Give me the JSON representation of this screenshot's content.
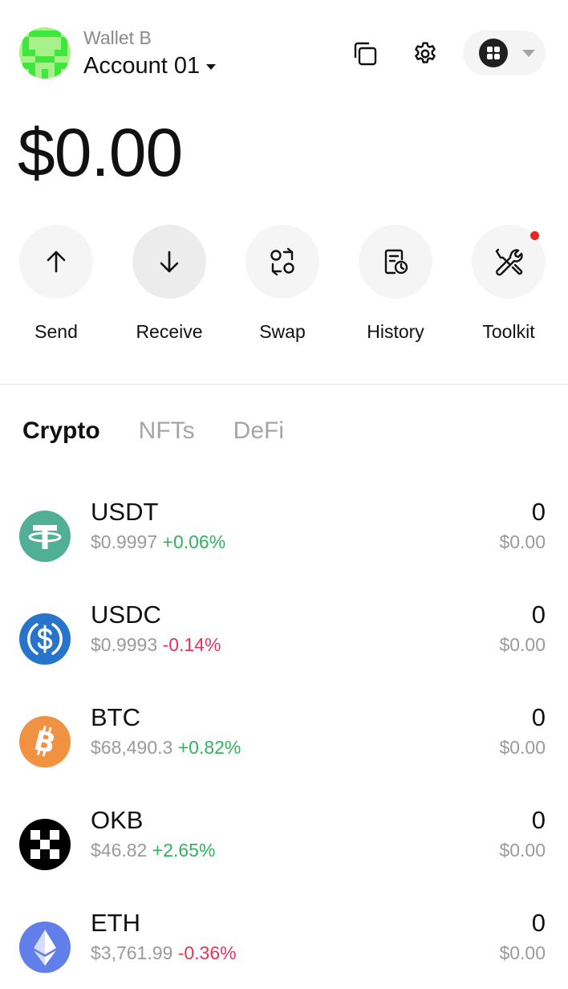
{
  "header": {
    "wallet_name": "Wallet B",
    "account_name": "Account 01"
  },
  "balance": "$0.00",
  "actions": [
    {
      "label": "Send",
      "icon": "arrow-up-icon"
    },
    {
      "label": "Receive",
      "icon": "arrow-down-icon"
    },
    {
      "label": "Swap",
      "icon": "swap-icon"
    },
    {
      "label": "History",
      "icon": "history-icon"
    },
    {
      "label": "Toolkit",
      "icon": "toolkit-icon"
    }
  ],
  "tabs": [
    {
      "label": "Crypto",
      "active": true
    },
    {
      "label": "NFTs",
      "active": false
    },
    {
      "label": "DeFi",
      "active": false
    }
  ],
  "tokens": [
    {
      "symbol": "USDT",
      "price": "$0.9997",
      "change": "+0.06%",
      "amount": "0",
      "value": "$0.00",
      "icon": "tether-icon",
      "color": "#50af95"
    },
    {
      "symbol": "USDC",
      "price": "$0.9993",
      "change": "-0.14%",
      "amount": "0",
      "value": "$0.00",
      "icon": "usdc-icon",
      "color": "#2775ca"
    },
    {
      "symbol": "BTC",
      "price": "$68,490.3",
      "change": "+0.82%",
      "amount": "0",
      "value": "$0.00",
      "icon": "bitcoin-icon",
      "color": "#f09242"
    },
    {
      "symbol": "OKB",
      "price": "$46.82",
      "change": "+2.65%",
      "amount": "0",
      "value": "$0.00",
      "icon": "okb-icon",
      "color": "#000000"
    },
    {
      "symbol": "ETH",
      "price": "$3,761.99",
      "change": "-0.36%",
      "amount": "0",
      "value": "$0.00",
      "icon": "ethereum-icon",
      "color": "#627eea"
    }
  ],
  "colors": {
    "positive": "#2fb35f",
    "negative": "#e4345c",
    "notification_dot": "#e8281f"
  }
}
